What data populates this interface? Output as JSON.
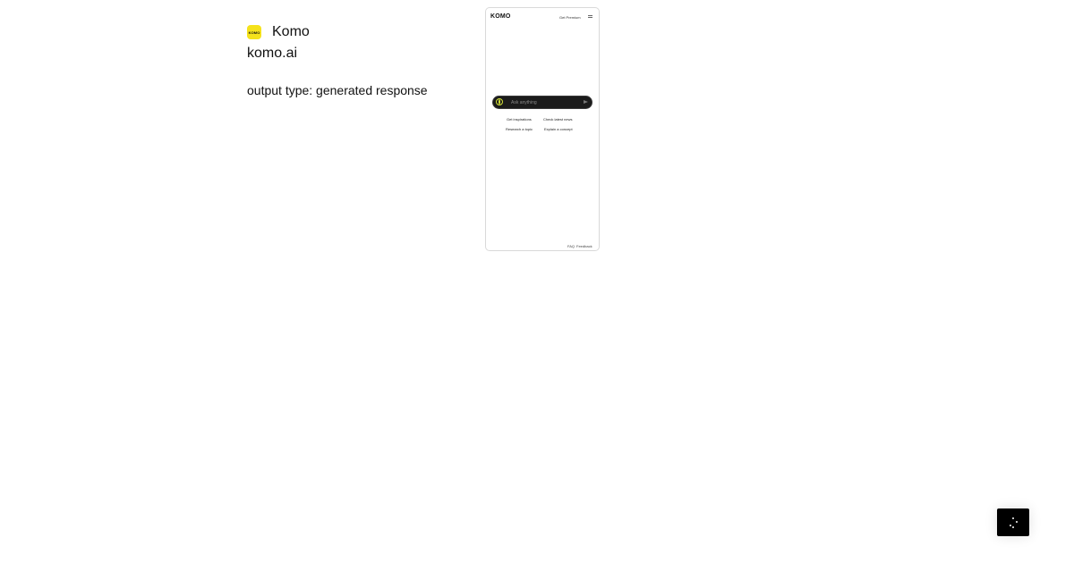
{
  "app": {
    "name": "Komo",
    "domain": "komo.ai",
    "output_type": "output type: generated response",
    "logo_text": "KOMO",
    "logo_color": "#f5e21b"
  },
  "screenshot": {
    "logo": "KOMO",
    "premium_label": "Get Premium",
    "menu_icon": "hamburger-icon",
    "search": {
      "placeholder": "Ask anything",
      "globe_icon": "globe-icon",
      "send_icon": "send-icon",
      "accent_color": "#d6e33a"
    },
    "suggestions": [
      "Get inspirations",
      "Check latest news",
      "Research a topic",
      "Explain a concept"
    ],
    "footer": {
      "faq": "FAQ",
      "feedback": "Feedback"
    }
  },
  "floating_button": {
    "icon": "spinner-icon",
    "color": "#000000"
  }
}
